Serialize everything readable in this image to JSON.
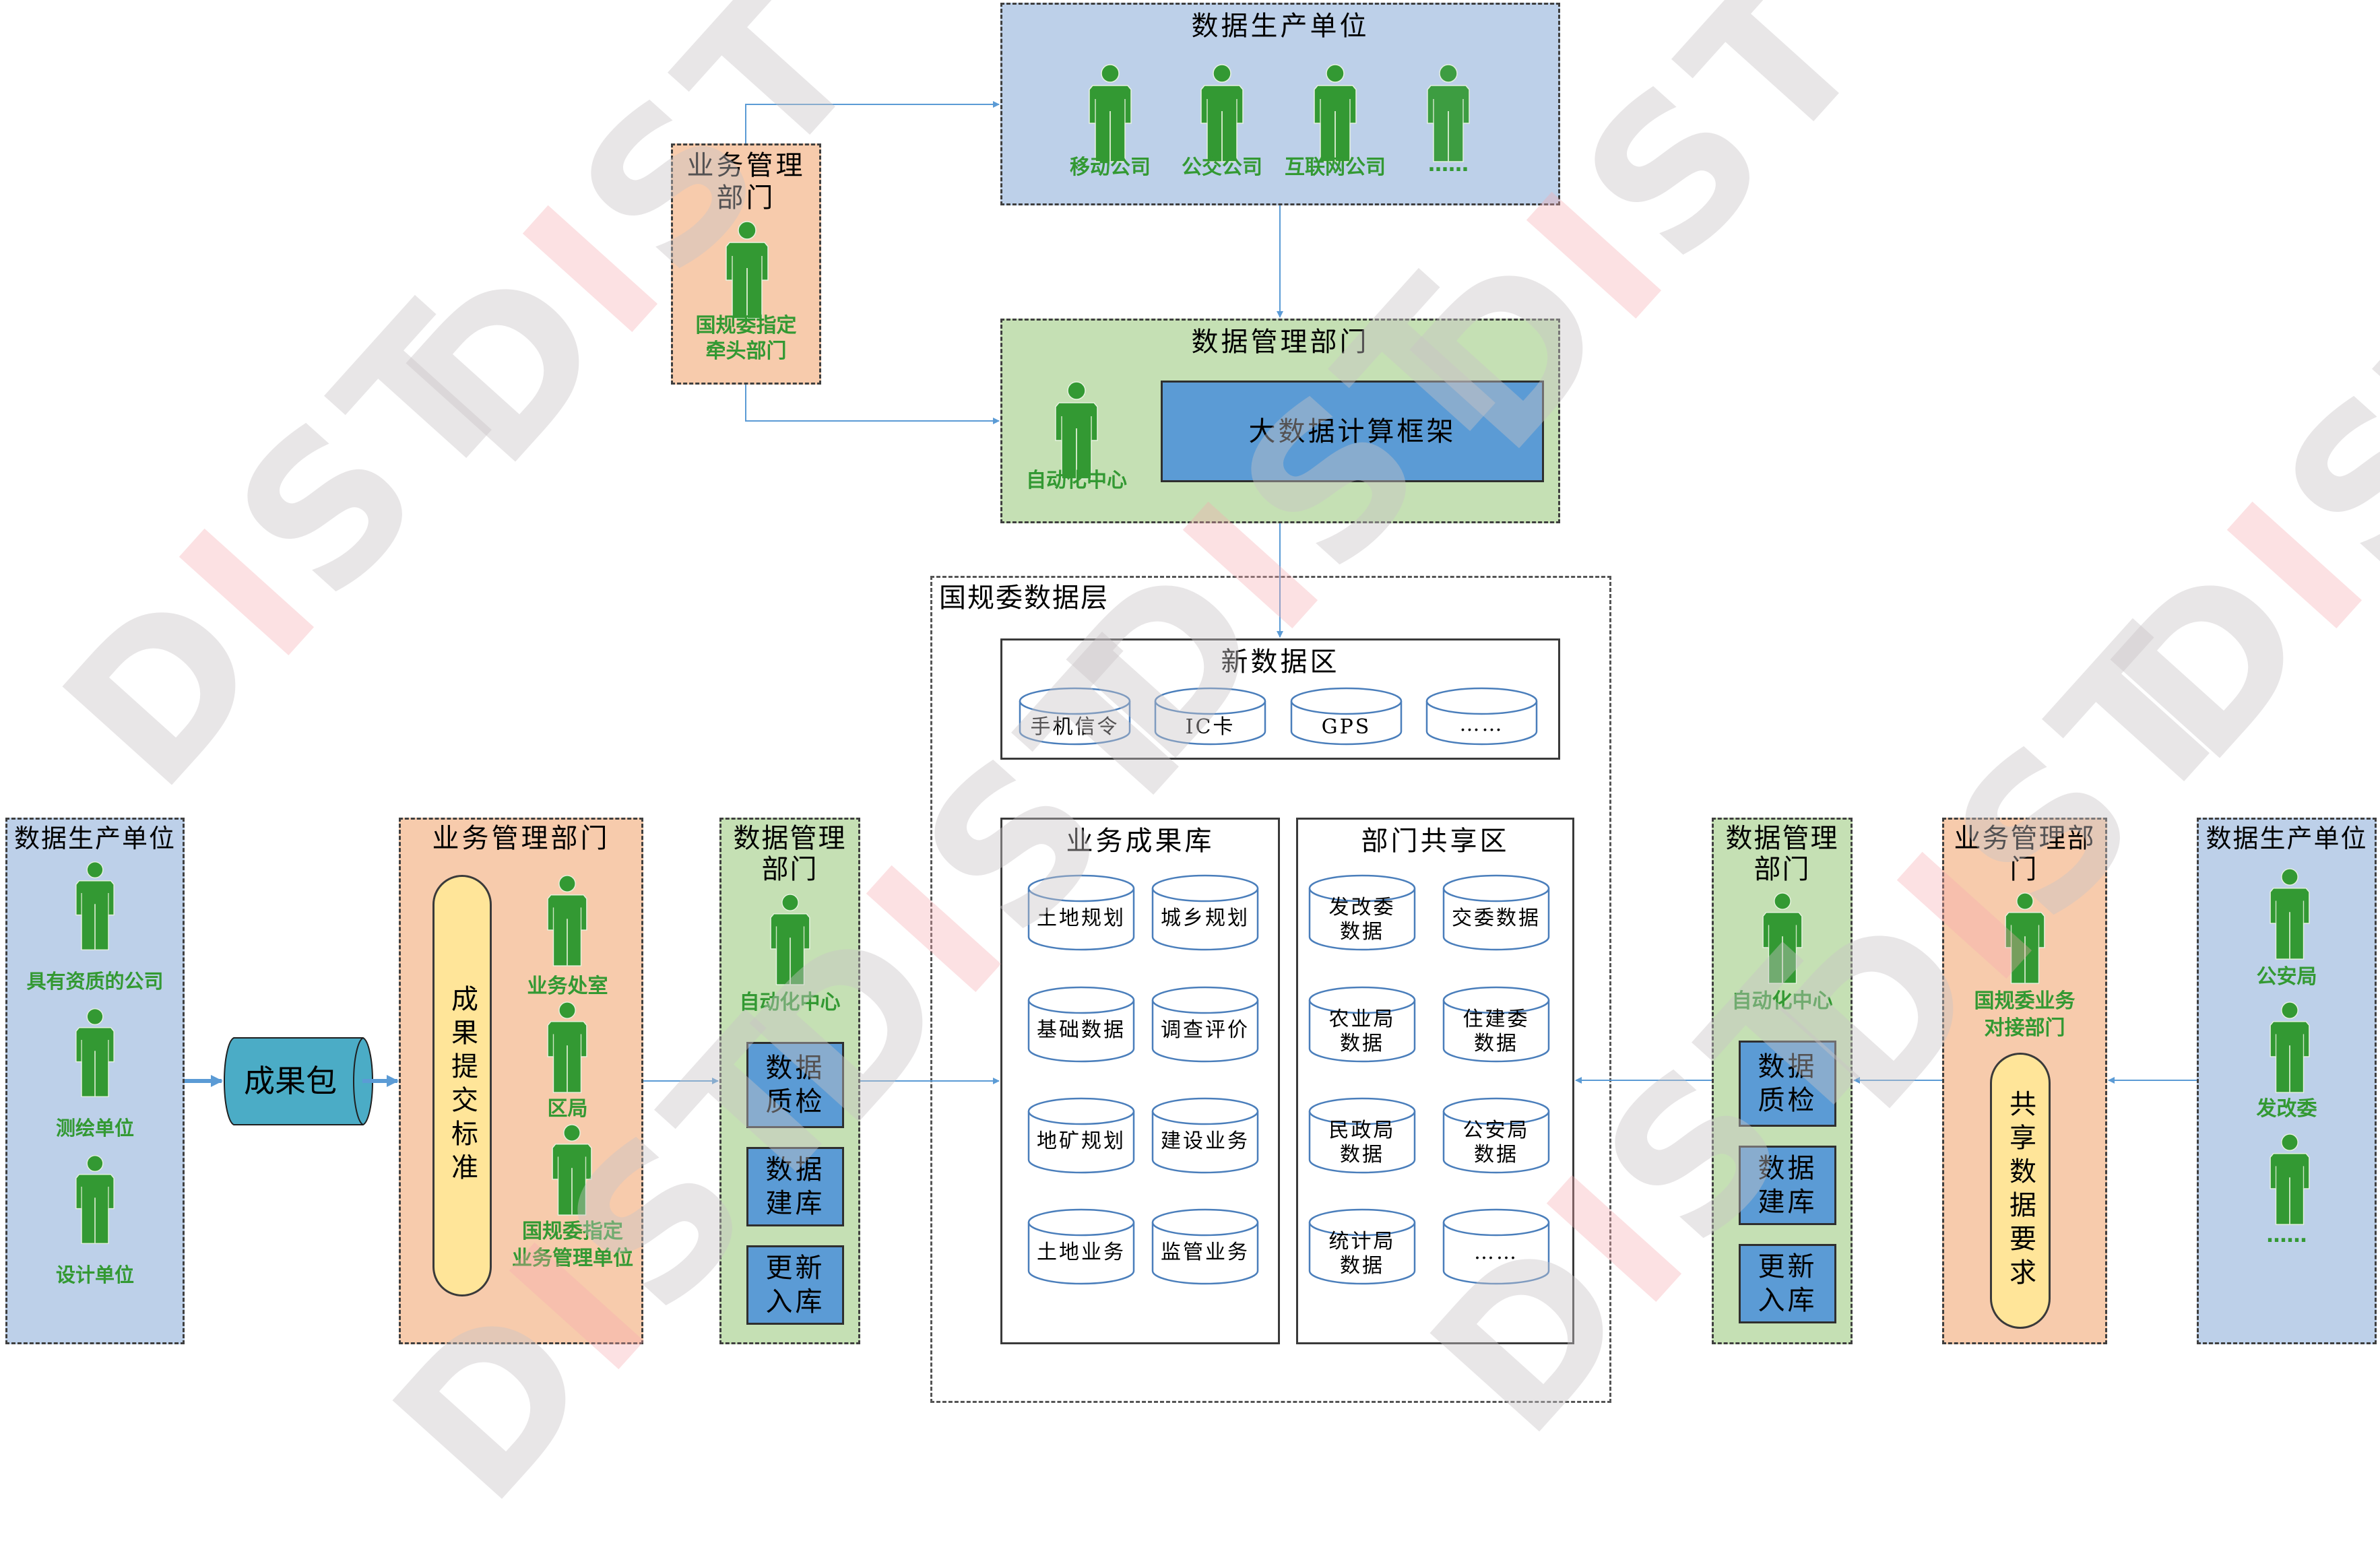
{
  "watermark": {
    "text_d": "D",
    "text_i": "I",
    "text_st": "ST"
  },
  "colors": {
    "producer_bg": "#bdd0e9",
    "data_mgmt_bg": "#c5e0b4",
    "business_mgmt_bg": "#f7cbac",
    "process_box": "#5b9bd5",
    "standard_pill": "#ffe599",
    "package": "#4bacc6",
    "person_icon": "#339933",
    "connector": "#5b9bd5"
  },
  "top_producer": {
    "title": "数据生产单位",
    "people": [
      {
        "label": "移动公司"
      },
      {
        "label": "公交公司"
      },
      {
        "label": "互联网公司"
      },
      {
        "label": "……"
      }
    ]
  },
  "top_business": {
    "title_line1": "业务管理",
    "title_line2": "部门",
    "person_line1": "国规委指定",
    "person_line2": "牵头部门"
  },
  "middle_data_mgmt": {
    "title": "数据管理部门",
    "person": "自动化中心",
    "framework": "大数据计算框架"
  },
  "data_layer": {
    "title": "国规委数据层",
    "new_zone": {
      "title": "新数据区",
      "items": [
        "手机信令",
        "IC卡",
        "GPS",
        "……"
      ]
    },
    "results_lib": {
      "title": "业务成果库",
      "items": [
        {
          "l1": "土地规划",
          "l2": ""
        },
        {
          "l1": "城乡规划",
          "l2": ""
        },
        {
          "l1": "基础数据",
          "l2": ""
        },
        {
          "l1": "调查评价",
          "l2": ""
        },
        {
          "l1": "地矿规划",
          "l2": ""
        },
        {
          "l1": "建设业务",
          "l2": ""
        },
        {
          "l1": "土地业务",
          "l2": ""
        },
        {
          "l1": "监管业务",
          "l2": ""
        }
      ]
    },
    "sharing_zone": {
      "title": "部门共享区",
      "items": [
        {
          "l1": "发改委",
          "l2": "数据"
        },
        {
          "l1": "交委数据",
          "l2": ""
        },
        {
          "l1": "农业局",
          "l2": "数据"
        },
        {
          "l1": "住建委",
          "l2": "数据"
        },
        {
          "l1": "民政局",
          "l2": "数据"
        },
        {
          "l1": "公安局",
          "l2": "数据"
        },
        {
          "l1": "统计局",
          "l2": "数据"
        },
        {
          "l1": "……",
          "l2": ""
        }
      ]
    }
  },
  "left_producer": {
    "title": "数据生产单位",
    "people": [
      {
        "label": "具有资质的公司"
      },
      {
        "label": "测绘单位"
      },
      {
        "label": "设计单位"
      }
    ]
  },
  "package": {
    "label": "成果包"
  },
  "left_business": {
    "title": "业务管理部门",
    "standard": "成果提交标准",
    "people": [
      {
        "l1": "业务处室",
        "l2": ""
      },
      {
        "l1": "区局",
        "l2": ""
      },
      {
        "l1": "国规委指定",
        "l2": "业务管理单位"
      }
    ]
  },
  "left_data_mgmt": {
    "title_line1": "数据管理",
    "title_line2": "部门",
    "person": "自动化中心",
    "steps": [
      {
        "l1": "数据",
        "l2": "质检"
      },
      {
        "l1": "数据",
        "l2": "建库"
      },
      {
        "l1": "更新",
        "l2": "入库"
      }
    ]
  },
  "right_data_mgmt": {
    "title_line1": "数据管理",
    "title_line2": "部门",
    "person": "自动化中心",
    "steps": [
      {
        "l1": "数据",
        "l2": "质检"
      },
      {
        "l1": "数据",
        "l2": "建库"
      },
      {
        "l1": "更新",
        "l2": "入库"
      }
    ]
  },
  "right_business": {
    "title_line1": "业务管理部",
    "title_line2": "门",
    "person_line1": "国规委业务",
    "person_line2": "对接部门",
    "requirement": "共享数据要求"
  },
  "right_producer": {
    "title": "数据生产单位",
    "people": [
      {
        "label": "公安局"
      },
      {
        "label": "发改委"
      },
      {
        "label": "……"
      }
    ]
  }
}
